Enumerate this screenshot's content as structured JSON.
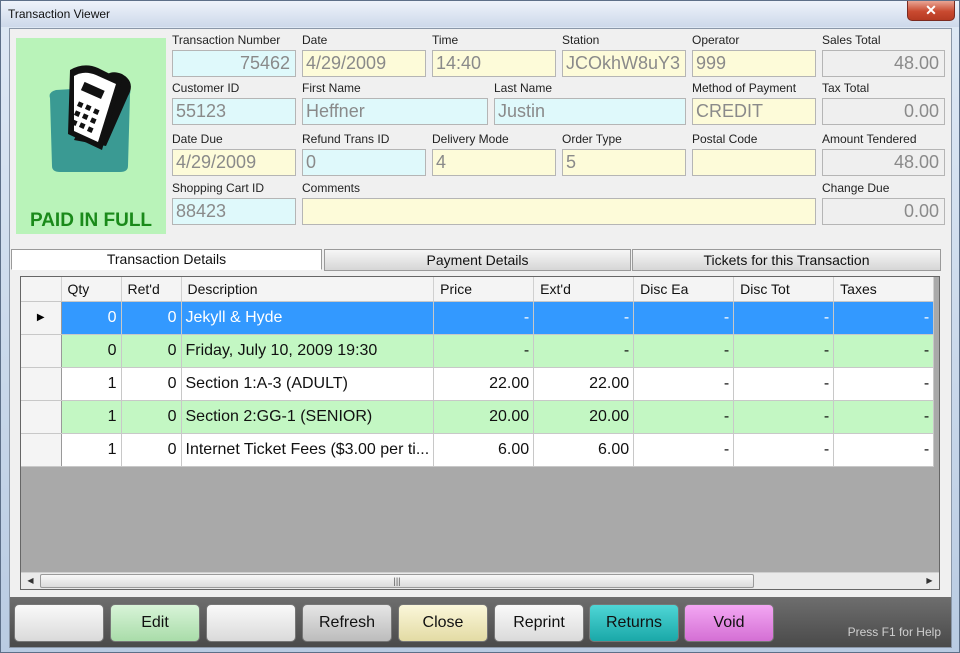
{
  "window": {
    "title": "Transaction Viewer",
    "close_glyph": "✕"
  },
  "status": {
    "label": "PAID IN FULL",
    "icon": "receipt-icon"
  },
  "fields": {
    "transaction_number": {
      "label": "Transaction Number",
      "value": "75462"
    },
    "date": {
      "label": "Date",
      "value": "4/29/2009"
    },
    "time": {
      "label": "Time",
      "value": "14:40"
    },
    "station": {
      "label": "Station",
      "value": "JCOkhW8uY3"
    },
    "operator": {
      "label": "Operator",
      "value": "999"
    },
    "sales_total": {
      "label": "Sales Total",
      "value": "48.00"
    },
    "customer_id": {
      "label": "Customer ID",
      "value": "55123"
    },
    "first_name": {
      "label": "First Name",
      "value": "Heffner"
    },
    "last_name": {
      "label": "Last Name",
      "value": "Justin"
    },
    "method_of_payment": {
      "label": "Method of Payment",
      "value": "CREDIT"
    },
    "tax_total": {
      "label": "Tax Total",
      "value": "0.00"
    },
    "date_due": {
      "label": "Date Due",
      "value": "4/29/2009"
    },
    "refund_trans_id": {
      "label": "Refund Trans ID",
      "value": "0"
    },
    "delivery_mode": {
      "label": "Delivery Mode",
      "value": "4"
    },
    "order_type": {
      "label": "Order Type",
      "value": "5"
    },
    "postal_code": {
      "label": "Postal Code",
      "value": ""
    },
    "amount_tendered": {
      "label": "Amount Tendered",
      "value": "48.00"
    },
    "shopping_cart_id": {
      "label": "Shopping Cart ID",
      "value": "88423"
    },
    "comments": {
      "label": "Comments",
      "value": ""
    },
    "change_due": {
      "label": "Change Due",
      "value": "0.00"
    }
  },
  "tabs": [
    {
      "label": "Transaction Details",
      "active": true
    },
    {
      "label": "Payment Details",
      "active": false
    },
    {
      "label": "Tickets for this Transaction",
      "active": false
    }
  ],
  "grid": {
    "columns": [
      "",
      "Qty",
      "Ret'd",
      "Description",
      "Price",
      "Ext'd",
      "Disc Ea",
      "Disc Tot",
      "Taxes"
    ],
    "rows": [
      {
        "marker": "▶",
        "style": "selected",
        "cells": [
          "0",
          "0",
          "Jekyll & Hyde",
          "-",
          "-",
          "-",
          "-",
          "-"
        ]
      },
      {
        "marker": "",
        "style": "green",
        "cells": [
          "0",
          "0",
          "Friday, July 10, 2009  19:30",
          "-",
          "-",
          "-",
          "-",
          "-"
        ]
      },
      {
        "marker": "",
        "style": "white",
        "cells": [
          "1",
          "0",
          "Section 1:A-3 (ADULT)",
          "22.00",
          "22.00",
          "-",
          "-",
          "-"
        ]
      },
      {
        "marker": "",
        "style": "green",
        "cells": [
          "1",
          "0",
          "Section 2:GG-1 (SENIOR)",
          "20.00",
          "20.00",
          "-",
          "-",
          "-"
        ]
      },
      {
        "marker": "",
        "style": "white",
        "cells": [
          "1",
          "0",
          "Internet Ticket Fees ($3.00 per ti...",
          "6.00",
          "6.00",
          "-",
          "-",
          "-"
        ]
      }
    ],
    "scroll": {
      "left_arrow": "◀",
      "right_arrow": "▶",
      "thumb_grip": "|||"
    }
  },
  "buttons": {
    "blank1": "",
    "edit": "Edit",
    "blank2": "",
    "refresh": "Refresh",
    "close": "Close",
    "reprint": "Reprint",
    "returns": "Returns",
    "void": "Void"
  },
  "help_text": "Press F1 for Help",
  "colors": {
    "paid_panel": "#b9f3b9",
    "paid_text": "#1a8a1a",
    "selected_row": "#3399ff",
    "green_row": "#c3f7c3",
    "returns_button": "#1aa8a8",
    "void_button": "#d46fd4"
  }
}
